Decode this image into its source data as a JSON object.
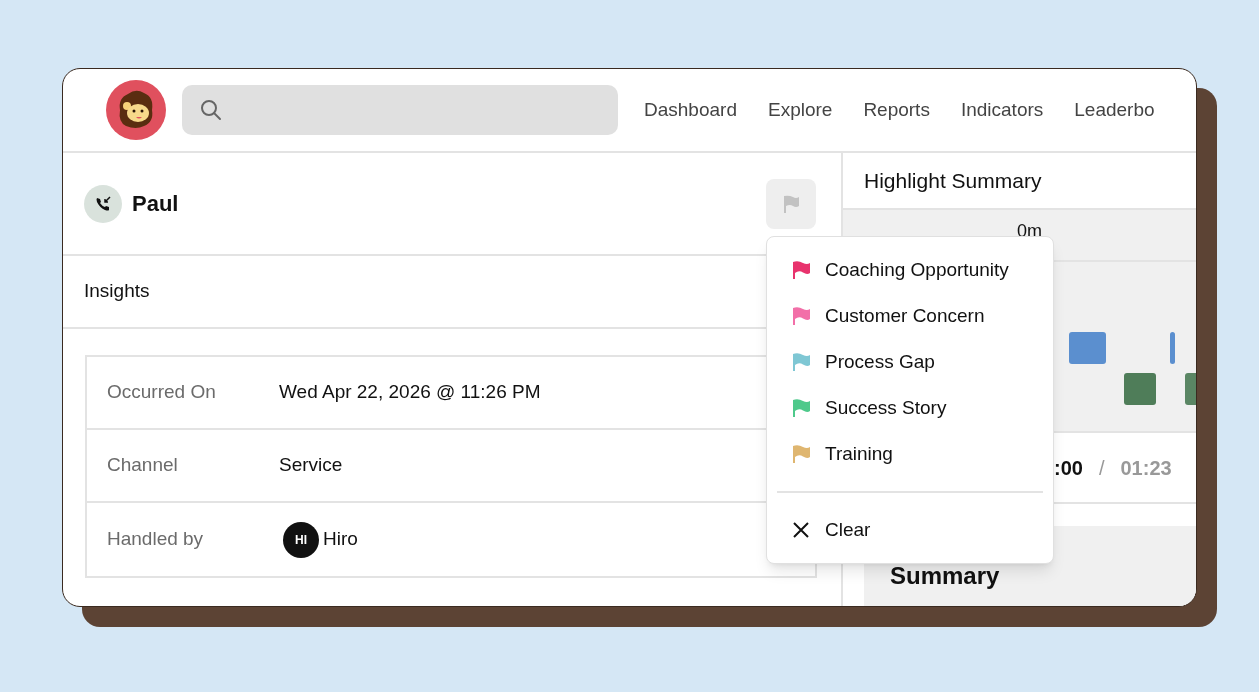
{
  "nav": [
    {
      "label": "Dashboard"
    },
    {
      "label": "Explore"
    },
    {
      "label": "Reports"
    },
    {
      "label": "Indicators"
    },
    {
      "label": "Leaderbo"
    }
  ],
  "interaction": {
    "name": "Paul"
  },
  "insights": {
    "title": "Insights"
  },
  "details": [
    {
      "kind": "text",
      "label": "Occurred On",
      "value": "Wed Apr 22, 2026 @ 11:26 PM"
    },
    {
      "kind": "text",
      "label": "Channel",
      "value": "Service"
    },
    {
      "kind": "person",
      "label": "Handled by",
      "initials": "HI",
      "value": "Hiro"
    }
  ],
  "highlight_summary": {
    "title": "Highlight Summary",
    "timeline_start": "0m",
    "current_time": ":00",
    "separator": "/",
    "duration": "01:23"
  },
  "summary": {
    "title": "Summary"
  },
  "flag_menu": {
    "items": [
      {
        "kind": "flag",
        "label": "Coaching Opportunity",
        "color": "#e8336d"
      },
      {
        "kind": "flag",
        "label": "Customer Concern",
        "color": "#f26fa8"
      },
      {
        "kind": "flag",
        "label": "Process Gap",
        "color": "#7fc7d4"
      },
      {
        "kind": "flag",
        "label": "Success Story",
        "color": "#4ec98b"
      },
      {
        "kind": "flag",
        "label": "Training",
        "color": "#dfb670"
      },
      {
        "kind": "clear",
        "label": "Clear"
      }
    ]
  }
}
